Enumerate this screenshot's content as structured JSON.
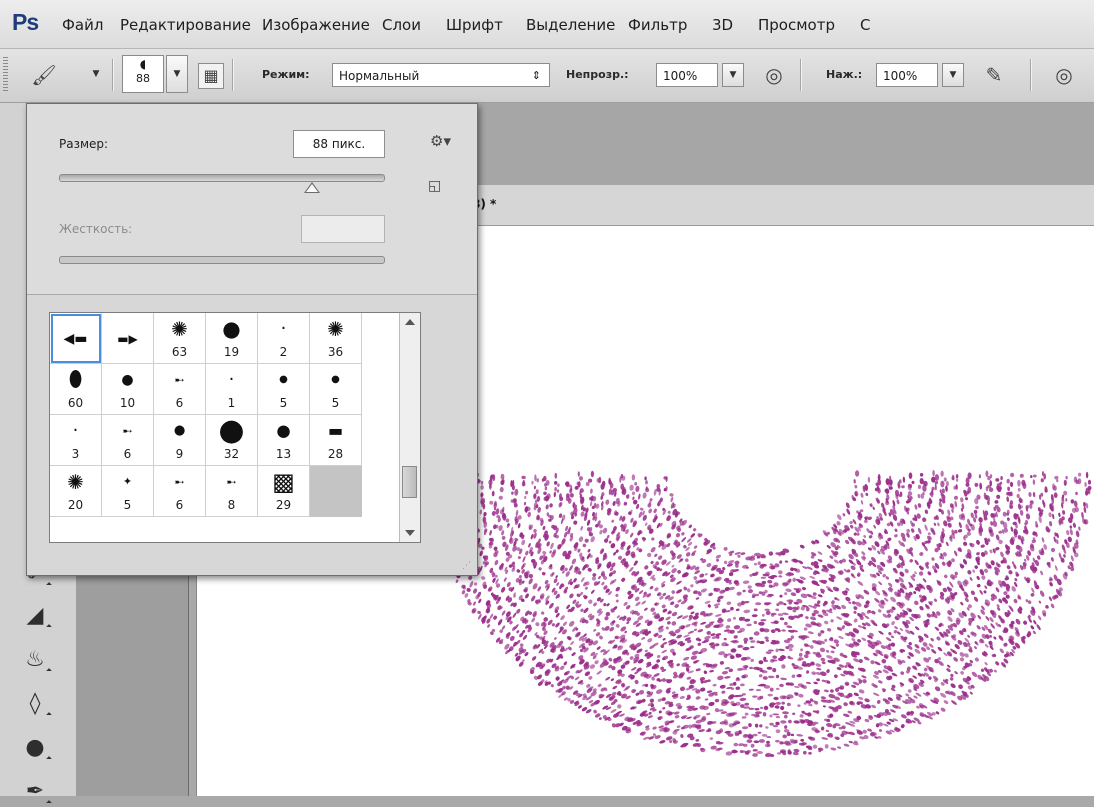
{
  "app": {
    "logo": "Ps"
  },
  "menu": [
    "Файл",
    "Редактирование",
    "Изображение",
    "Слои",
    "Шрифт",
    "Выделение",
    "Фильтр",
    "3D",
    "Просмотр",
    "С"
  ],
  "options": {
    "brush_size_preview": "88",
    "mode_label": "Режим:",
    "mode_value": "Нормальный",
    "opacity_label": "Непрозр.:",
    "opacity_value": "100%",
    "pressure_label": "Наж.:",
    "pressure_value": "100%"
  },
  "brush_panel": {
    "size_label": "Размер:",
    "size_value": "88 пикс.",
    "size_slider_fraction": 0.78,
    "hardness_label": "Жесткость:",
    "hardness_value": "",
    "presets": [
      {
        "num": "",
        "icon": "airbrush-icon",
        "selected": true
      },
      {
        "num": "",
        "icon": "marker-icon"
      },
      {
        "num": "63",
        "icon": "scatter-icon"
      },
      {
        "num": "19",
        "icon": "round-icon"
      },
      {
        "num": "2",
        "icon": "dot-icon"
      },
      {
        "num": "36",
        "icon": "scatter-icon"
      },
      {
        "num": "60",
        "icon": "ellipse-icon"
      },
      {
        "num": "10",
        "icon": "round-icon"
      },
      {
        "num": "6",
        "icon": "leaf-icon"
      },
      {
        "num": "1",
        "icon": "dot-icon"
      },
      {
        "num": "5",
        "icon": "round-icon"
      },
      {
        "num": "5",
        "icon": "round-icon"
      },
      {
        "num": "3",
        "icon": "dot-icon"
      },
      {
        "num": "6",
        "icon": "leaf-icon"
      },
      {
        "num": "9",
        "icon": "round-icon"
      },
      {
        "num": "32",
        "icon": "round-icon"
      },
      {
        "num": "13",
        "icon": "round-icon"
      },
      {
        "num": "28",
        "icon": "flat-icon"
      },
      {
        "num": "20",
        "icon": "scatter-icon"
      },
      {
        "num": "5",
        "icon": "star-icon"
      },
      {
        "num": "6",
        "icon": "leaf-icon"
      },
      {
        "num": "8",
        "icon": "leaf-icon"
      },
      {
        "num": "29",
        "icon": "texture-icon"
      }
    ]
  },
  "document": {
    "tab_title": "8) *"
  },
  "colors": {
    "stroke": "#9b2f8b",
    "selection": "#4a8cde"
  }
}
